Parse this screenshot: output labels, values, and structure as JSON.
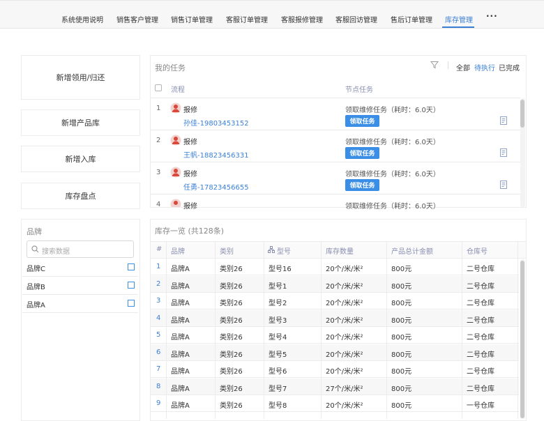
{
  "nav": {
    "tabs": [
      {
        "label": "系统使用说明"
      },
      {
        "label": "销售客户管理"
      },
      {
        "label": "销售订单管理"
      },
      {
        "label": "客服订单管理"
      },
      {
        "label": "客服报修管理"
      },
      {
        "label": "客服回访管理"
      },
      {
        "label": "售后订单管理"
      },
      {
        "label": "库存管理"
      }
    ],
    "more": "···",
    "active_tab": "库存管理"
  },
  "actions": [
    {
      "label": "新增领用/归还"
    },
    {
      "label": "新增产品库"
    },
    {
      "label": "新增入库"
    },
    {
      "label": "库存盘点"
    }
  ],
  "tasks": {
    "title": "我的任务",
    "filters": {
      "all": "全部",
      "pending": "待执行",
      "done": "已完成"
    },
    "columns": {
      "flow": "流程",
      "node": "节点任务"
    },
    "rows": [
      {
        "index": "1",
        "type": "报修",
        "person": "孙佳-19803453152",
        "desc": "领取维修任务（耗时：6.0天）",
        "button": "领取任务"
      },
      {
        "index": "2",
        "type": "报修",
        "person": "王帆-18823456331",
        "desc": "领取维修任务（耗时：6.0天）",
        "button": "领取任务"
      },
      {
        "index": "3",
        "type": "报修",
        "person": "任勇-17823456655",
        "desc": "领取维修任务（耗时：6.0天）",
        "button": "领取任务"
      },
      {
        "index": "4",
        "type": "报修",
        "person": "",
        "desc": "领取维修任务（耗时：6.0天）",
        "button": ""
      }
    ]
  },
  "brand_filter": {
    "title": "品牌",
    "search_placeholder": "搜索数据",
    "items": [
      {
        "label": "品牌C",
        "checked": false
      },
      {
        "label": "品牌B",
        "checked": false
      },
      {
        "label": "品牌A",
        "checked": false
      }
    ]
  },
  "inventory": {
    "title": "库存一览 (共128条)",
    "columns": {
      "index": "#",
      "brand": "品牌",
      "category": "类别",
      "model": "型号",
      "qty": "库存数量",
      "amount": "产品总计金额",
      "warehouse": "仓库号"
    },
    "rows": [
      {
        "index": "1",
        "brand": "品牌A",
        "category": "类别26",
        "model": "型号16",
        "qty": "20个/米/米²",
        "amount": "800元",
        "warehouse": "二号仓库"
      },
      {
        "index": "2",
        "brand": "品牌A",
        "category": "类别26",
        "model": "型号1",
        "qty": "20个/米/米²",
        "amount": "800元",
        "warehouse": "二号仓库"
      },
      {
        "index": "3",
        "brand": "品牌A",
        "category": "类别26",
        "model": "型号2",
        "qty": "20个/米/米²",
        "amount": "800元",
        "warehouse": "二号仓库"
      },
      {
        "index": "4",
        "brand": "品牌A",
        "category": "类别26",
        "model": "型号3",
        "qty": "20个/米/米²",
        "amount": "800元",
        "warehouse": "二号仓库"
      },
      {
        "index": "5",
        "brand": "品牌A",
        "category": "类别26",
        "model": "型号4",
        "qty": "20个/米/米²",
        "amount": "800元",
        "warehouse": "二号仓库"
      },
      {
        "index": "6",
        "brand": "品牌A",
        "category": "类别26",
        "model": "型号5",
        "qty": "20个/米/米²",
        "amount": "800元",
        "warehouse": "二号仓库"
      },
      {
        "index": "7",
        "brand": "品牌A",
        "category": "类别26",
        "model": "型号6",
        "qty": "20个/米/米²",
        "amount": "800元",
        "warehouse": "二号仓库"
      },
      {
        "index": "8",
        "brand": "品牌A",
        "category": "类别26",
        "model": "型号7",
        "qty": "27个/米/米²",
        "amount": "800元",
        "warehouse": "二号仓库"
      },
      {
        "index": "9",
        "brand": "品牌A",
        "category": "类别26",
        "model": "型号8",
        "qty": "20个/米/米²",
        "amount": "800元",
        "warehouse": "一号仓库"
      }
    ]
  },
  "colors": {
    "accent": "#3a7fd5",
    "button": "#3a8ee6"
  }
}
